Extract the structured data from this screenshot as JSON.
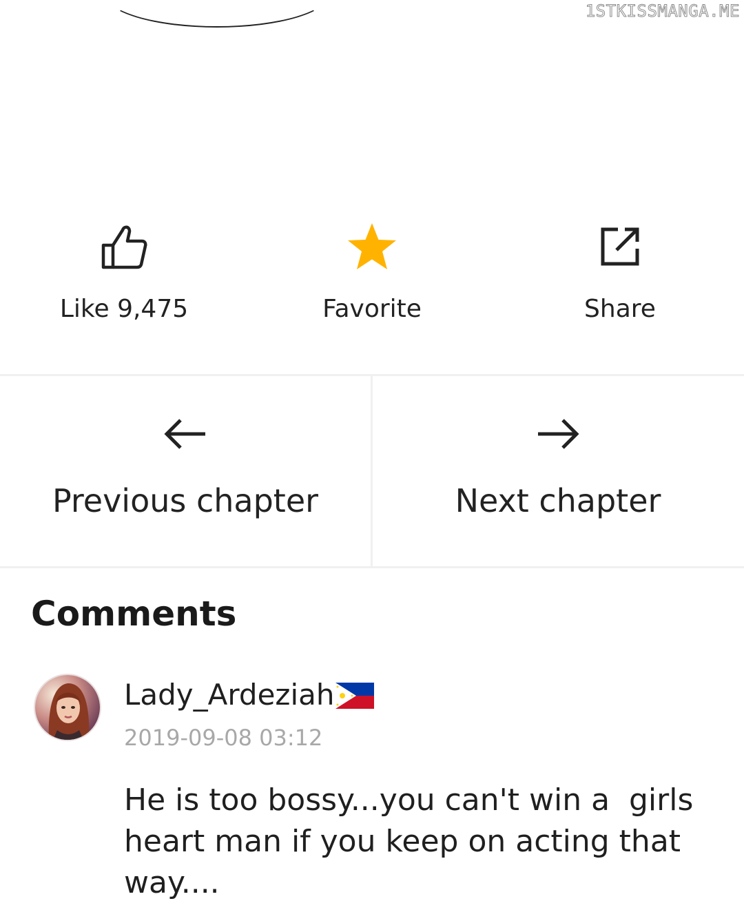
{
  "watermark": "1STKISSMANGA.ME",
  "actions": {
    "like": {
      "label": "Like 9,475",
      "icon": "thumbs-up-icon"
    },
    "favorite": {
      "label": "Favorite",
      "icon": "star-icon",
      "color": "#FFB300"
    },
    "share": {
      "label": "Share",
      "icon": "external-share-icon"
    }
  },
  "navigation": {
    "previous": {
      "label": "Previous chapter",
      "icon": "arrow-left-icon"
    },
    "next": {
      "label": "Next chapter",
      "icon": "arrow-right-icon"
    }
  },
  "comments": {
    "title": "Comments",
    "items": [
      {
        "username": "Lady_Ardeziah",
        "flag": "philippines-flag-icon",
        "timestamp": "2019-09-08 03:12",
        "text": "He is too bossy...you can't win a  girls heart man if you keep on acting that way...."
      }
    ]
  }
}
